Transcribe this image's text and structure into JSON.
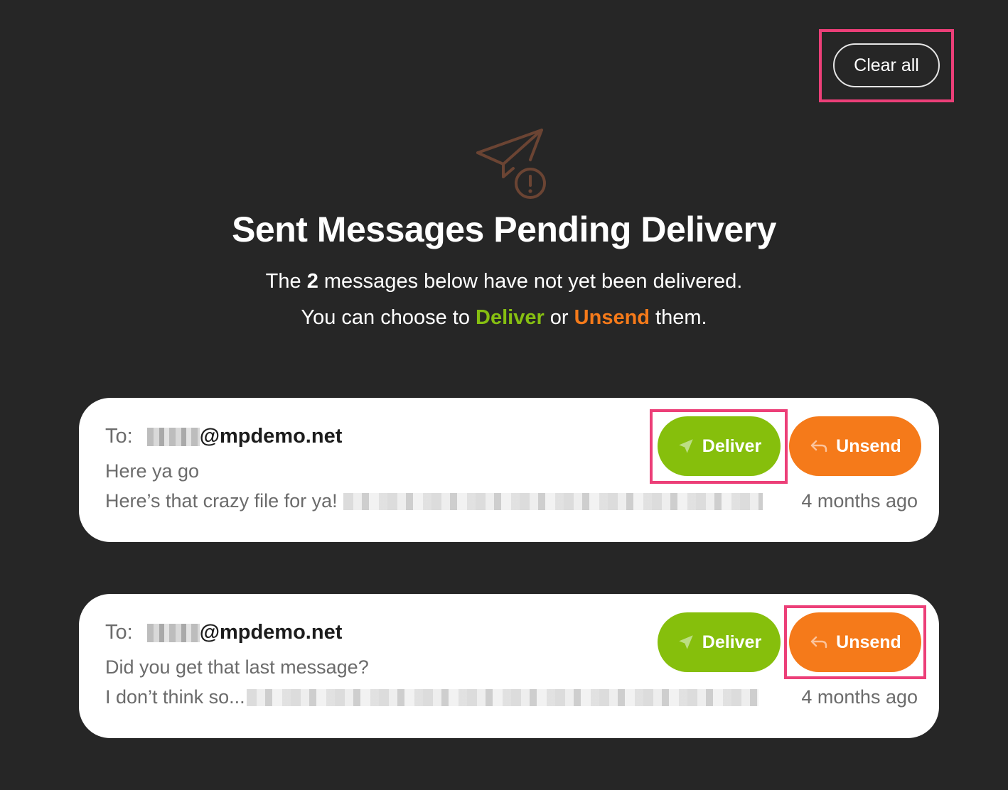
{
  "toolbar": {
    "clear_all_label": "Clear all"
  },
  "header": {
    "icon": "paper-plane-alert-icon",
    "title": "Sent Messages Pending Delivery",
    "subtitle_line1_pre": "The ",
    "subtitle_count": "2",
    "subtitle_line1_post": " messages below have not yet been delivered.",
    "subtitle_line2_pre": "You can choose to ",
    "subtitle_deliver_word": "Deliver",
    "subtitle_or": " or ",
    "subtitle_unsend_word": "Unsend",
    "subtitle_line2_post": " them."
  },
  "colors": {
    "background": "#262626",
    "deliver": "#86bf0c",
    "unsend": "#f57a1a",
    "highlight": "#ec3f78",
    "icon_brown": "#6b4433"
  },
  "messages": [
    {
      "to_label": "To:",
      "address_domain": "@mpdemo.net",
      "subject": "Here ya go",
      "preview": "Here’s that crazy file for ya!",
      "time": "4 months ago",
      "deliver_label": "Deliver",
      "unsend_label": "Unsend"
    },
    {
      "to_label": "To:",
      "address_domain": "@mpdemo.net",
      "subject": "Did you get that last message?",
      "preview": "I don’t think so...",
      "time": "4 months ago",
      "deliver_label": "Deliver",
      "unsend_label": "Unsend"
    }
  ]
}
